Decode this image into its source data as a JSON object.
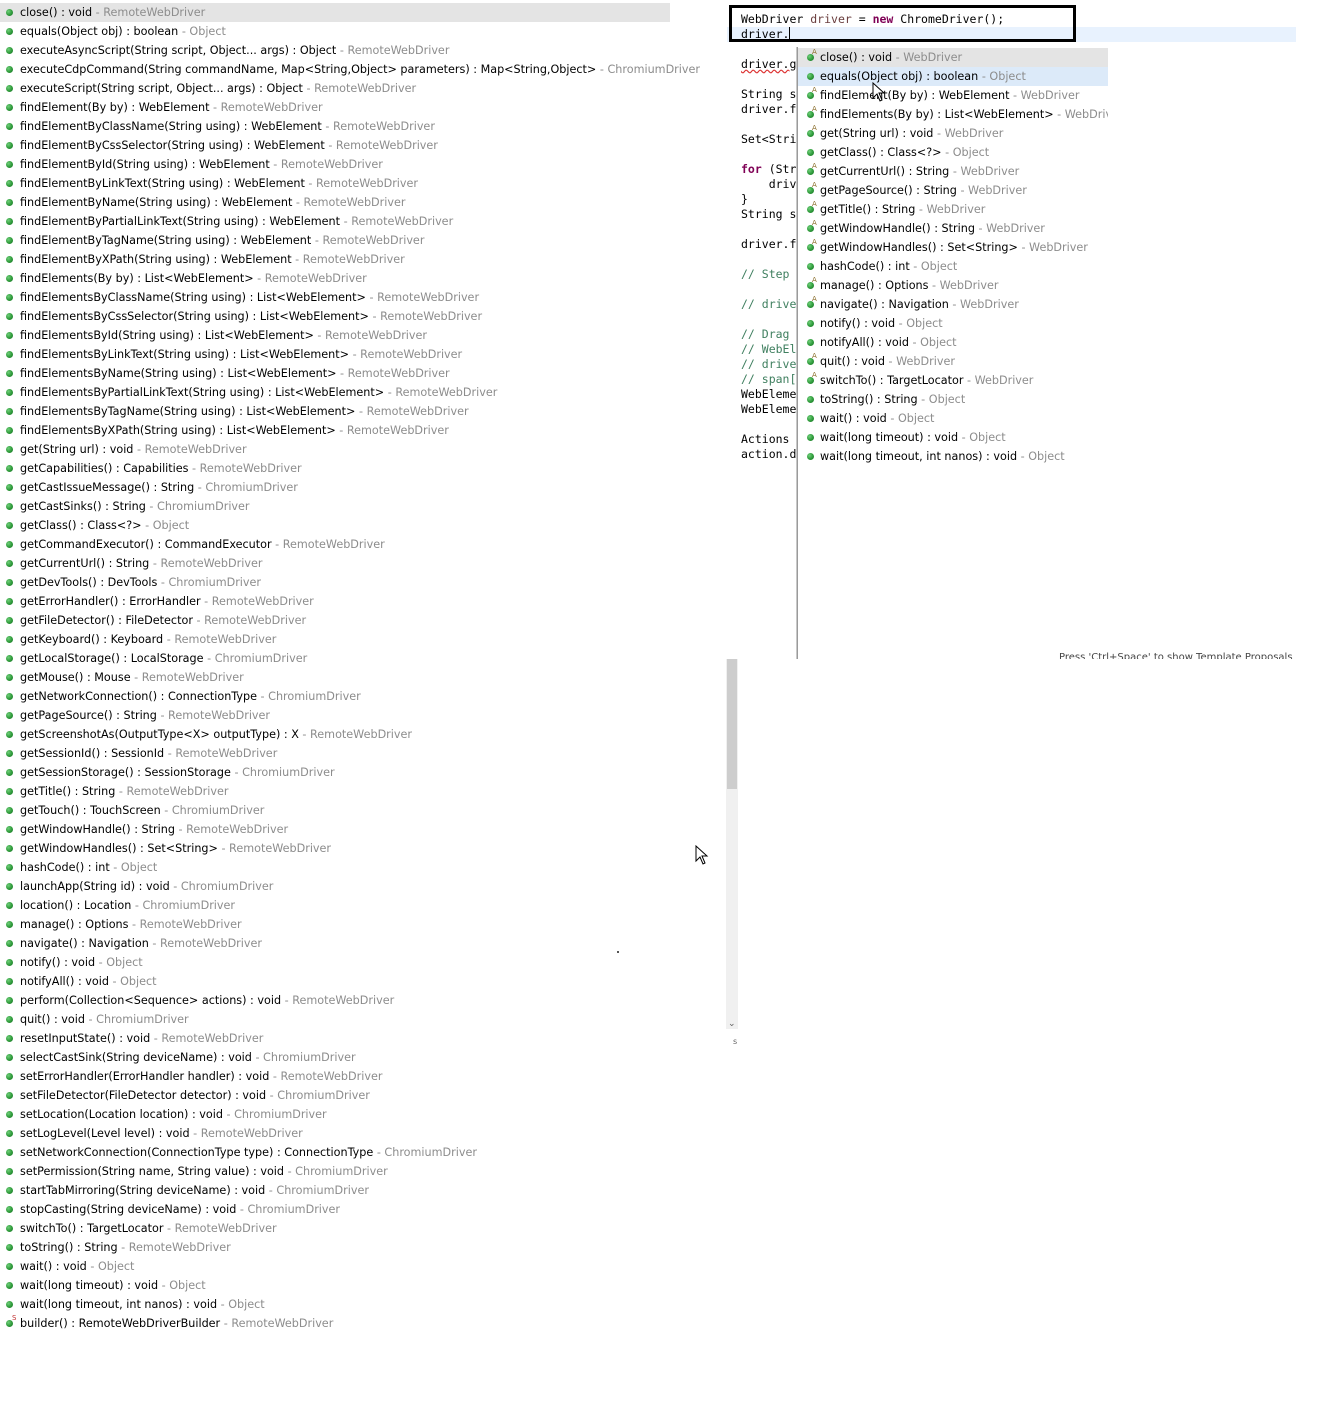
{
  "left_list": [
    {
      "sig": "close() : void",
      "owner": "RemoteWebDriver",
      "selected": true,
      "mark": ""
    },
    {
      "sig": "equals(Object obj) : boolean",
      "owner": "Object",
      "mark": ""
    },
    {
      "sig": "executeAsyncScript(String script, Object... args) : Object",
      "owner": "RemoteWebDriver",
      "mark": ""
    },
    {
      "sig": "executeCdpCommand(String commandName, Map<String,Object> parameters) : Map<String,Object>",
      "owner": "ChromiumDriver",
      "mark": ""
    },
    {
      "sig": "executeScript(String script, Object... args) : Object",
      "owner": "RemoteWebDriver",
      "mark": ""
    },
    {
      "sig": "findElement(By by) : WebElement",
      "owner": "RemoteWebDriver",
      "mark": ""
    },
    {
      "sig": "findElementByClassName(String using) : WebElement",
      "owner": "RemoteWebDriver",
      "mark": ""
    },
    {
      "sig": "findElementByCssSelector(String using) : WebElement",
      "owner": "RemoteWebDriver",
      "mark": ""
    },
    {
      "sig": "findElementById(String using) : WebElement",
      "owner": "RemoteWebDriver",
      "mark": ""
    },
    {
      "sig": "findElementByLinkText(String using) : WebElement",
      "owner": "RemoteWebDriver",
      "mark": ""
    },
    {
      "sig": "findElementByName(String using) : WebElement",
      "owner": "RemoteWebDriver",
      "mark": ""
    },
    {
      "sig": "findElementByPartialLinkText(String using) : WebElement",
      "owner": "RemoteWebDriver",
      "mark": ""
    },
    {
      "sig": "findElementByTagName(String using) : WebElement",
      "owner": "RemoteWebDriver",
      "mark": ""
    },
    {
      "sig": "findElementByXPath(String using) : WebElement",
      "owner": "RemoteWebDriver",
      "mark": ""
    },
    {
      "sig": "findElements(By by) : List<WebElement>",
      "owner": "RemoteWebDriver",
      "mark": ""
    },
    {
      "sig": "findElementsByClassName(String using) : List<WebElement>",
      "owner": "RemoteWebDriver",
      "mark": ""
    },
    {
      "sig": "findElementsByCssSelector(String using) : List<WebElement>",
      "owner": "RemoteWebDriver",
      "mark": ""
    },
    {
      "sig": "findElementsById(String using) : List<WebElement>",
      "owner": "RemoteWebDriver",
      "mark": ""
    },
    {
      "sig": "findElementsByLinkText(String using) : List<WebElement>",
      "owner": "RemoteWebDriver",
      "mark": ""
    },
    {
      "sig": "findElementsByName(String using) : List<WebElement>",
      "owner": "RemoteWebDriver",
      "mark": ""
    },
    {
      "sig": "findElementsByPartialLinkText(String using) : List<WebElement>",
      "owner": "RemoteWebDriver",
      "mark": ""
    },
    {
      "sig": "findElementsByTagName(String using) : List<WebElement>",
      "owner": "RemoteWebDriver",
      "mark": ""
    },
    {
      "sig": "findElementsByXPath(String using) : List<WebElement>",
      "owner": "RemoteWebDriver",
      "mark": ""
    },
    {
      "sig": "get(String url) : void",
      "owner": "RemoteWebDriver",
      "mark": ""
    },
    {
      "sig": "getCapabilities() : Capabilities",
      "owner": "RemoteWebDriver",
      "mark": ""
    },
    {
      "sig": "getCastIssueMessage() : String",
      "owner": "ChromiumDriver",
      "mark": ""
    },
    {
      "sig": "getCastSinks() : String",
      "owner": "ChromiumDriver",
      "mark": ""
    },
    {
      "sig": "getClass() : Class<?>",
      "owner": "Object",
      "mark": ""
    },
    {
      "sig": "getCommandExecutor() : CommandExecutor",
      "owner": "RemoteWebDriver",
      "mark": ""
    },
    {
      "sig": "getCurrentUrl() : String",
      "owner": "RemoteWebDriver",
      "mark": ""
    },
    {
      "sig": "getDevTools() : DevTools",
      "owner": "ChromiumDriver",
      "mark": ""
    },
    {
      "sig": "getErrorHandler() : ErrorHandler",
      "owner": "RemoteWebDriver",
      "mark": ""
    },
    {
      "sig": "getFileDetector() : FileDetector",
      "owner": "RemoteWebDriver",
      "mark": ""
    },
    {
      "sig": "getKeyboard() : Keyboard",
      "owner": "RemoteWebDriver",
      "mark": ""
    },
    {
      "sig": "getLocalStorage() : LocalStorage",
      "owner": "ChromiumDriver",
      "mark": ""
    },
    {
      "sig": "getMouse() : Mouse",
      "owner": "RemoteWebDriver",
      "mark": ""
    },
    {
      "sig": "getNetworkConnection() : ConnectionType",
      "owner": "ChromiumDriver",
      "mark": ""
    },
    {
      "sig": "getPageSource() : String",
      "owner": "RemoteWebDriver",
      "mark": ""
    },
    {
      "sig": "getScreenshotAs(OutputType<X> outputType) : X",
      "owner": "RemoteWebDriver",
      "mark": ""
    },
    {
      "sig": "getSessionId() : SessionId",
      "owner": "RemoteWebDriver",
      "mark": ""
    },
    {
      "sig": "getSessionStorage() : SessionStorage",
      "owner": "ChromiumDriver",
      "mark": ""
    },
    {
      "sig": "getTitle() : String",
      "owner": "RemoteWebDriver",
      "mark": ""
    },
    {
      "sig": "getTouch() : TouchScreen",
      "owner": "ChromiumDriver",
      "mark": ""
    },
    {
      "sig": "getWindowHandle() : String",
      "owner": "RemoteWebDriver",
      "mark": ""
    },
    {
      "sig": "getWindowHandles() : Set<String>",
      "owner": "RemoteWebDriver",
      "mark": ""
    },
    {
      "sig": "hashCode() : int",
      "owner": "Object",
      "mark": ""
    },
    {
      "sig": "launchApp(String id) : void",
      "owner": "ChromiumDriver",
      "mark": ""
    },
    {
      "sig": "location() : Location",
      "owner": "ChromiumDriver",
      "mark": ""
    },
    {
      "sig": "manage() : Options",
      "owner": "RemoteWebDriver",
      "mark": ""
    },
    {
      "sig": "navigate() : Navigation",
      "owner": "RemoteWebDriver",
      "mark": ""
    },
    {
      "sig": "notify() : void",
      "owner": "Object",
      "mark": ""
    },
    {
      "sig": "notifyAll() : void",
      "owner": "Object",
      "mark": ""
    },
    {
      "sig": "perform(Collection<Sequence> actions) : void",
      "owner": "RemoteWebDriver",
      "mark": ""
    },
    {
      "sig": "quit() : void",
      "owner": "ChromiumDriver",
      "mark": ""
    },
    {
      "sig": "resetInputState() : void",
      "owner": "RemoteWebDriver",
      "mark": ""
    },
    {
      "sig": "selectCastSink(String deviceName) : void",
      "owner": "ChromiumDriver",
      "mark": ""
    },
    {
      "sig": "setErrorHandler(ErrorHandler handler) : void",
      "owner": "RemoteWebDriver",
      "mark": ""
    },
    {
      "sig": "setFileDetector(FileDetector detector) : void",
      "owner": "ChromiumDriver",
      "mark": ""
    },
    {
      "sig": "setLocation(Location location) : void",
      "owner": "ChromiumDriver",
      "mark": ""
    },
    {
      "sig": "setLogLevel(Level level) : void",
      "owner": "RemoteWebDriver",
      "mark": ""
    },
    {
      "sig": "setNetworkConnection(ConnectionType type) : ConnectionType",
      "owner": "ChromiumDriver",
      "mark": ""
    },
    {
      "sig": "setPermission(String name, String value) : void",
      "owner": "ChromiumDriver",
      "mark": ""
    },
    {
      "sig": "startTabMirroring(String deviceName) : void",
      "owner": "ChromiumDriver",
      "mark": ""
    },
    {
      "sig": "stopCasting(String deviceName) : void",
      "owner": "ChromiumDriver",
      "mark": ""
    },
    {
      "sig": "switchTo() : TargetLocator",
      "owner": "RemoteWebDriver",
      "mark": ""
    },
    {
      "sig": "toString() : String",
      "owner": "RemoteWebDriver",
      "mark": ""
    },
    {
      "sig": "wait() : void",
      "owner": "Object",
      "mark": ""
    },
    {
      "sig": "wait(long timeout) : void",
      "owner": "Object",
      "mark": ""
    },
    {
      "sig": "wait(long timeout, int nanos) : void",
      "owner": "Object",
      "mark": ""
    },
    {
      "sig": "builder() : RemoteWebDriverBuilder",
      "owner": "RemoteWebDriver",
      "mark": "S"
    }
  ],
  "editor": {
    "lines": [
      [
        {
          "t": "WebDriver ",
          "c": ""
        },
        {
          "t": "driver",
          "c": "var"
        },
        {
          "t": " = ",
          "c": ""
        },
        {
          "t": "new",
          "c": "kw"
        },
        {
          "t": " ChromeDriver();",
          "c": ""
        }
      ],
      [
        {
          "t": "driver.",
          "c": ""
        },
        {
          "t": "",
          "c": "caret"
        }
      ],
      [
        {
          "t": "",
          "c": ""
        }
      ],
      [
        {
          "t": "driver.g",
          "c": "squig"
        }
      ],
      [
        {
          "t": "",
          "c": ""
        }
      ],
      [
        {
          "t": "String s",
          "c": ""
        }
      ],
      [
        {
          "t": "driver.f",
          "c": ""
        }
      ],
      [
        {
          "t": "",
          "c": ""
        }
      ],
      [
        {
          "t": "Set<Stri",
          "c": ""
        }
      ],
      [
        {
          "t": "",
          "c": ""
        }
      ],
      [
        {
          "t": "for",
          "c": "kw"
        },
        {
          "t": " (Str",
          "c": ""
        }
      ],
      [
        {
          "t": "    driv",
          "c": ""
        }
      ],
      [
        {
          "t": "}",
          "c": ""
        }
      ],
      [
        {
          "t": "String s",
          "c": ""
        }
      ],
      [
        {
          "t": "",
          "c": ""
        }
      ],
      [
        {
          "t": "driver.f",
          "c": ""
        }
      ],
      [
        {
          "t": "",
          "c": ""
        }
      ],
      [
        {
          "t": "// Step ",
          "c": "cm"
        }
      ],
      [
        {
          "t": "",
          "c": ""
        }
      ],
      [
        {
          "t": "// drive",
          "c": "cm"
        }
      ],
      [
        {
          "t": "",
          "c": ""
        }
      ],
      [
        {
          "t": "// Drag ",
          "c": "cm"
        }
      ],
      [
        {
          "t": "// WebEl",
          "c": "cm"
        }
      ],
      [
        {
          "t": "// drive",
          "c": "cm"
        }
      ],
      [
        {
          "t": "// span[",
          "c": "cm"
        }
      ],
      [
        {
          "t": "WebEleme",
          "c": ""
        }
      ],
      [
        {
          "t": "WebEleme",
          "c": ""
        }
      ],
      [
        {
          "t": "",
          "c": ""
        }
      ],
      [
        {
          "t": "Actions ",
          "c": ""
        }
      ],
      [
        {
          "t": "action.d",
          "c": ""
        }
      ]
    ]
  },
  "popup": {
    "items": [
      {
        "sig": "close() : void",
        "owner": "WebDriver",
        "mark": "A",
        "state": "sel"
      },
      {
        "sig": "equals(Object obj) : boolean",
        "owner": "Object",
        "mark": "",
        "state": "hov"
      },
      {
        "sig": "findElement(By by) : WebElement",
        "owner": "WebDriver",
        "mark": "A"
      },
      {
        "sig": "findElements(By by) : List<WebElement>",
        "owner": "WebDriver",
        "mark": "A"
      },
      {
        "sig": "get(String url) : void",
        "owner": "WebDriver",
        "mark": "A"
      },
      {
        "sig": "getClass() : Class<?>",
        "owner": "Object",
        "mark": ""
      },
      {
        "sig": "getCurrentUrl() : String",
        "owner": "WebDriver",
        "mark": "A"
      },
      {
        "sig": "getPageSource() : String",
        "owner": "WebDriver",
        "mark": "A"
      },
      {
        "sig": "getTitle() : String",
        "owner": "WebDriver",
        "mark": "A"
      },
      {
        "sig": "getWindowHandle() : String",
        "owner": "WebDriver",
        "mark": "A"
      },
      {
        "sig": "getWindowHandles() : Set<String>",
        "owner": "WebDriver",
        "mark": "A"
      },
      {
        "sig": "hashCode() : int",
        "owner": "Object",
        "mark": ""
      },
      {
        "sig": "manage() : Options",
        "owner": "WebDriver",
        "mark": "A"
      },
      {
        "sig": "navigate() : Navigation",
        "owner": "WebDriver",
        "mark": "A"
      },
      {
        "sig": "notify() : void",
        "owner": "Object",
        "mark": ""
      },
      {
        "sig": "notifyAll() : void",
        "owner": "Object",
        "mark": ""
      },
      {
        "sig": "quit() : void",
        "owner": "WebDriver",
        "mark": "A"
      },
      {
        "sig": "switchTo() : TargetLocator",
        "owner": "WebDriver",
        "mark": "A"
      },
      {
        "sig": "toString() : String",
        "owner": "Object",
        "mark": ""
      },
      {
        "sig": "wait() : void",
        "owner": "Object",
        "mark": ""
      },
      {
        "sig": "wait(long timeout) : void",
        "owner": "Object",
        "mark": ""
      },
      {
        "sig": "wait(long timeout, int nanos) : void",
        "owner": "Object",
        "mark": ""
      }
    ],
    "hint": "Press 'Ctrl+Space' to show Template Proposals"
  },
  "misc": {
    "tiny_char": "s"
  },
  "icons": {
    "method": "public-method-icon",
    "scrollbar_arrow": "chevron-down-icon"
  }
}
